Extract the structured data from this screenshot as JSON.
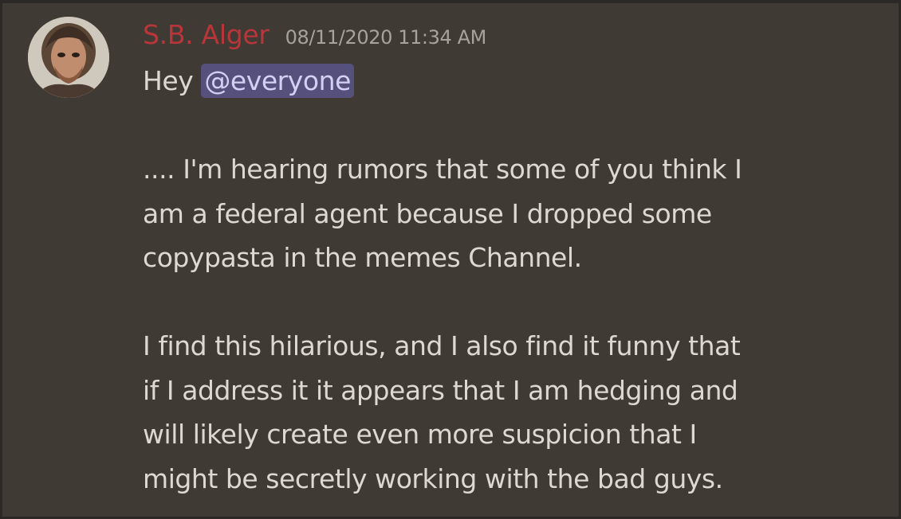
{
  "message": {
    "author": "S.B. Alger",
    "timestamp": "08/11/2020 11:34 AM",
    "greeting": "Hey",
    "mention": "@everyone",
    "paragraph1": [
      ".... I'm hearing rumors that some of you think I",
      "am a federal agent because I dropped some",
      "copypasta in the memes Channel."
    ],
    "paragraph2": [
      "I find this hilarious, and I also find it funny that",
      "if I address it it appears that I am hedging and",
      "will likely create even more suspicion that I",
      "might be secretly working with the bad guys."
    ]
  },
  "colors": {
    "background": "#403a34",
    "username": "#b8353a",
    "timestamp": "#a7a29b",
    "text": "#ddd9d2",
    "mention_bg": "#55507c",
    "mention_text": "#d4d0f4"
  }
}
